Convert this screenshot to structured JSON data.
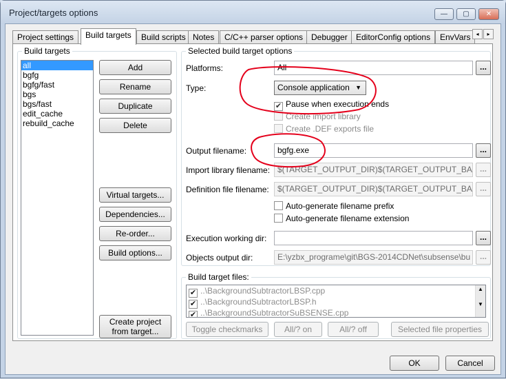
{
  "window": {
    "title": "Project/targets options",
    "minimize_glyph": "—",
    "maximize_glyph": "▢",
    "close_glyph": "✕"
  },
  "tabs": [
    {
      "label": "Project settings"
    },
    {
      "label": "Build targets"
    },
    {
      "label": "Build scripts"
    },
    {
      "label": "Notes"
    },
    {
      "label": "C/C++ parser options"
    },
    {
      "label": "Debugger"
    },
    {
      "label": "EditorConfig options"
    },
    {
      "label": "EnvVars"
    }
  ],
  "tab_scroll": {
    "left": "◂",
    "right": "▸"
  },
  "build_targets": {
    "group_title": "Build targets",
    "items": [
      "all",
      "bgfg",
      "bgfg/fast",
      "bgs",
      "bgs/fast",
      "edit_cache",
      "rebuild_cache"
    ],
    "selected": "all",
    "buttons": {
      "add": "Add",
      "rename": "Rename",
      "duplicate": "Duplicate",
      "delete": "Delete",
      "virtual": "Virtual targets...",
      "dependencies": "Dependencies...",
      "reorder": "Re-order...",
      "build_options": "Build options...",
      "create_project_line1": "Create project",
      "create_project_line2": "from target..."
    }
  },
  "selected_options": {
    "group_title": "Selected build target options",
    "platforms_label": "Platforms:",
    "platforms_value": "All",
    "type_label": "Type:",
    "type_value": "Console application",
    "pause_label": "Pause when execution ends",
    "pause_checked": true,
    "create_import_label": "Create import library",
    "create_def_label": "Create .DEF exports file",
    "output_label": "Output filename:",
    "output_value": "bgfg.exe",
    "import_label": "Import library filename:",
    "import_value": "$(TARGET_OUTPUT_DIR)$(TARGET_OUTPUT_BAS",
    "def_label": "Definition file filename:",
    "def_value": "$(TARGET_OUTPUT_DIR)$(TARGET_OUTPUT_BAS",
    "auto_prefix_label": "Auto-generate filename prefix",
    "auto_ext_label": "Auto-generate filename extension",
    "exec_dir_label": "Execution working dir:",
    "exec_dir_value": "",
    "obj_dir_label": "Objects output dir:",
    "obj_dir_value": "E:\\yzbx_programe\\git\\BGS-2014CDNet\\subsense\\bu",
    "browse": "..."
  },
  "files": {
    "group_title": "Build target files:",
    "items": [
      "..\\BackgroundSubtractorLBSP.cpp",
      "..\\BackgroundSubtractorLBSP.h",
      "..\\BackgroundSubtractorSuBSENSE.cpp"
    ],
    "check_mark": "✔",
    "buttons": {
      "toggle": "Toggle checkmarks",
      "all_on": "All/? on",
      "all_off": "All/? off",
      "props": "Selected file properties"
    }
  },
  "dialog_buttons": {
    "ok": "OK",
    "cancel": "Cancel"
  },
  "colors": {
    "annotation_red": "#e4001b",
    "selection": "#3399ff"
  }
}
